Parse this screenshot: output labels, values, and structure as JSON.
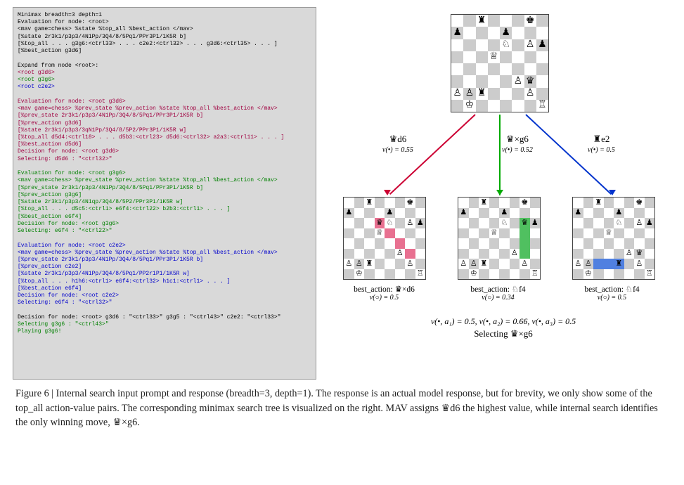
{
  "code_lines": [
    {
      "cls": "black",
      "text": "Minimax breadth=3 depth=1"
    },
    {
      "cls": "black",
      "text": "Evaluation for node: <root>"
    },
    {
      "cls": "black",
      "text": "<mav game=chess> %state %top_all %best_action </mav>"
    },
    {
      "cls": "black",
      "text": "[%state 2r3k1/p3p3/4N1Pp/3Q4/8/5Pq1/PPr3P1/1K5R b]"
    },
    {
      "cls": "black",
      "text": "[%top_all . . . g3g6:<ctrl33> . . . c2e2:<ctrl32> . . . g3d6:<ctrl35> . . . ]"
    },
    {
      "cls": "black",
      "text": "[%best_action g3d6]"
    },
    {
      "cls": "black",
      "text": ""
    },
    {
      "cls": "black",
      "text": "Expand from node <root>:"
    },
    {
      "cls": "darkred",
      "text": "<root g3d6>"
    },
    {
      "cls": "green",
      "text": "<root g3g6>"
    },
    {
      "cls": "blue",
      "text": "<root c2e2>"
    },
    {
      "cls": "black",
      "text": ""
    },
    {
      "cls": "darkred",
      "text": "Evaluation for node: <root g3d6>"
    },
    {
      "cls": "darkred",
      "text": "<mav game=chess> %prev_state %prev_action %state %top_all %best_action </mav>"
    },
    {
      "cls": "darkred",
      "text": "[%prev_state 2r3k1/p3p3/4N1Pp/3Q4/8/5Pq1/PPr3P1/1K5R b]"
    },
    {
      "cls": "darkred",
      "text": "[%prev_action g3d6]"
    },
    {
      "cls": "darkred",
      "text": "[%state 2r3k1/p3p3/3qN1Pp/3Q4/8/5P2/PPr3P1/1K5R w]"
    },
    {
      "cls": "darkred",
      "text": "[%top_all d5d4:<ctrl18> . . . d5b3:<ctrl23> d5d6:<ctrl32> a2a3:<ctrl11> . . . ]"
    },
    {
      "cls": "darkred",
      "text": "[%best_action d5d6]"
    },
    {
      "cls": "darkred",
      "text": "Decision for node: <root g3d6>"
    },
    {
      "cls": "darkred",
      "text": "Selecting: d5d6 : \"<ctrl32>\""
    },
    {
      "cls": "black",
      "text": ""
    },
    {
      "cls": "green",
      "text": "Evaluation for node: <root g3g6>"
    },
    {
      "cls": "green",
      "text": "<mav game=chess> %prev_state %prev_action %state %top_all %best_action </mav>"
    },
    {
      "cls": "green",
      "text": "[%prev_state 2r3k1/p3p3/4N1Pp/3Q4/8/5Pq1/PPr3P1/1K5R b]"
    },
    {
      "cls": "green",
      "text": "[%prev_action g3g6]"
    },
    {
      "cls": "green",
      "text": "[%state 2r3k1/p3p3/4N1qp/3Q4/8/5P2/PPr3P1/1K5R w]"
    },
    {
      "cls": "green",
      "text": "[%top_all . . . d5c5:<ctrl1> e6f4:<ctrl22> b2b3:<ctrl1> . . . ]"
    },
    {
      "cls": "green",
      "text": "[%best_action e6f4]"
    },
    {
      "cls": "green",
      "text": "Decision for node: <root g3g6>"
    },
    {
      "cls": "green",
      "text": "Selecting: e6f4 : \"<ctrl22>\""
    },
    {
      "cls": "black",
      "text": ""
    },
    {
      "cls": "blue",
      "text": "Evaluation for node: <root c2e2>"
    },
    {
      "cls": "blue",
      "text": "<mav game=chess> %prev_state %prev_action %state %top_all %best_action </mav>"
    },
    {
      "cls": "blue",
      "text": "[%prev_state 2r3k1/p3p3/4N1Pp/3Q4/8/5Pq1/PPr3P1/1K5R b]"
    },
    {
      "cls": "blue",
      "text": "[%prev_action c2e2]"
    },
    {
      "cls": "blue",
      "text": "[%state 2r3k1/p3p3/4N1Pp/3Q4/8/5Pq1/PP2r1P1/1K5R w]"
    },
    {
      "cls": "blue",
      "text": "[%top_all . . . h1h6:<ctrl1> e6f4:<ctrl32> h1c1:<ctrl1> . . . ]"
    },
    {
      "cls": "blue",
      "text": "[%best_action e6f4]"
    },
    {
      "cls": "blue",
      "text": "Decision for node: <root c2e2>"
    },
    {
      "cls": "blue",
      "text": "Selecting: e6f4 : \"<ctrl32>\""
    },
    {
      "cls": "black",
      "text": ""
    },
    {
      "cls": "black",
      "text": "Decision for node: <root> g3d6 : \"<ctrl33>\" g3g5 : \"<ctrl43>\" c2e2: \"<ctrl33>\""
    },
    {
      "cls": "green",
      "text": "Selecting g3g6 : \"<ctrl43>\""
    },
    {
      "cls": "green",
      "text": "Playing g3g6!"
    }
  ],
  "edges": {
    "e1": {
      "move": "♛d6",
      "val": "v(•) = 0.55"
    },
    "e2": {
      "move": "♛×g6",
      "val": "v(•) = 0.52"
    },
    "e3": {
      "move": "♜e2",
      "val": "v(•) = 0.5"
    }
  },
  "children": {
    "c1": {
      "best": "best_action: ♛×d6",
      "val": "v(○) = 0.5"
    },
    "c2": {
      "best": "best_action: ♘f4",
      "val": "v(○) = 0.34"
    },
    "c3": {
      "best": "best_action: ♘f4",
      "val": "v(○) = 0.5"
    }
  },
  "summary": {
    "vline": "v(•, a₁) = 0.5,   v(•, a₂) = 0.66,   v(•, a₃) = 0.5",
    "sel": "Selecting ♛×g6"
  },
  "caption": {
    "label": "Figure 6 | ",
    "text": "Internal search input prompt and response (breadth=3, depth=1). The response is an actual model response, but for brevity, we only show some of the top_all action-value pairs. The corresponding minimax search tree is visualized on the right. MAV assigns ♛d6 the highest value, while internal search identifies the only winning move, ♛×g6."
  },
  "chart_data": {
    "type": "tree",
    "title": "Minimax search tree (breadth=3, depth=1)",
    "root": {
      "fen": "2r3k1/p3p3/4N1Pp/3Q4/8/5Pq1/PPr3P1/1K5R b",
      "children": [
        {
          "action": "g3d6",
          "piece": "q",
          "label": "♛d6",
          "v_black": 0.55,
          "fen": "2r3k1/p3p3/3qN1Pp/3Q4/8/5P2/PPr3P1/1K5R w",
          "best_action": "d5d6",
          "best_label": "♛×d6",
          "v_white": 0.5,
          "v_minimax": 0.5
        },
        {
          "action": "g3g6",
          "piece": "q",
          "label": "♛×g6",
          "v_black": 0.52,
          "fen": "2r3k1/p3p3/4N1qp/3Q4/8/5P2/PPr3P1/1K5R w",
          "best_action": "e6f4",
          "best_label": "♘f4",
          "v_white": 0.34,
          "v_minimax": 0.66
        },
        {
          "action": "c2e2",
          "piece": "r",
          "label": "♜e2",
          "v_black": 0.5,
          "fen": "2r3k1/p3p3/4N1Pp/3Q4/8/5Pq1/PP2r1P1/1K5R w",
          "best_action": "e6f4",
          "best_label": "♘f4",
          "v_white": 0.5,
          "v_minimax": 0.5
        }
      ],
      "selected": "g3g6"
    }
  }
}
